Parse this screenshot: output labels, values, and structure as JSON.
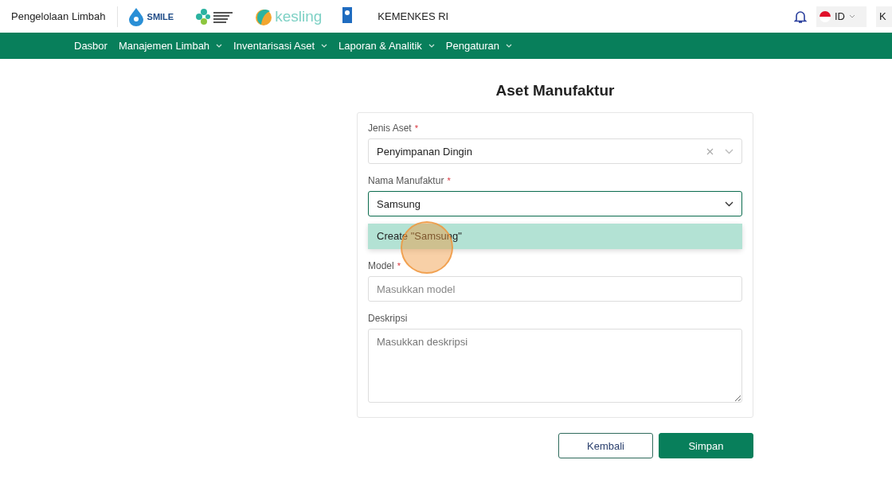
{
  "header": {
    "app_name": "Pengelolaan Limbah",
    "logos": [
      {
        "kind": "smile",
        "text": "SMILE"
      },
      {
        "kind": "kemenkes"
      },
      {
        "kind": "kesling",
        "text": "kesling"
      },
      {
        "kind": "undp"
      }
    ],
    "org": "KEMENKES RI",
    "language": "ID",
    "user_initials": "K"
  },
  "nav": [
    {
      "label": "Dasbor",
      "dropdown": false
    },
    {
      "label": "Manajemen Limbah",
      "dropdown": true
    },
    {
      "label": "Inventarisasi Aset",
      "dropdown": true
    },
    {
      "label": "Laporan & Analitik",
      "dropdown": true
    },
    {
      "label": "Pengaturan",
      "dropdown": true
    }
  ],
  "page_title": "Aset Manufaktur",
  "form": {
    "fields": [
      {
        "kind": "select",
        "label": "Jenis Aset",
        "required_mark": "*",
        "value": "Penyimpanan Dingin",
        "clearable": true,
        "focused": false
      },
      {
        "kind": "select",
        "label": "Nama Manufaktur",
        "required_mark": "*",
        "value": "Samsung",
        "clearable": false,
        "focused": true,
        "options": [
          {
            "label": "Create \"Samsung\"",
            "selected": true
          }
        ]
      },
      {
        "kind": "text",
        "label": "Model",
        "required_mark": "*",
        "placeholder": "Masukkan model"
      },
      {
        "kind": "textarea",
        "label": "Deskripsi",
        "placeholder": "Masukkan deskripsi"
      }
    ]
  },
  "buttons": [
    {
      "label": "Kembali",
      "kind": "secondary"
    },
    {
      "label": "Simpan",
      "kind": "primary"
    }
  ]
}
